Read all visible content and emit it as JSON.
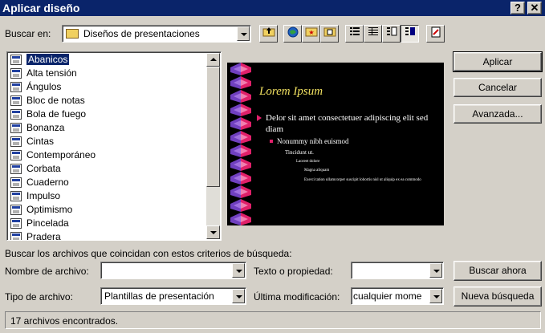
{
  "window": {
    "title": "Aplicar diseño",
    "help_label": "?",
    "close_label": "✕"
  },
  "toolbar": {
    "look_in_label": "Buscar en:",
    "look_in_value": "Diseños de presentaciones",
    "icons": [
      "up-folder-icon",
      "web-search-icon",
      "favorites-icon",
      "views-icon",
      "list-view-icon",
      "details-view-icon",
      "properties-view-icon",
      "preview-view-icon",
      "tools-icon"
    ]
  },
  "file_list": {
    "items": [
      "Abanicos",
      "Alta tensión",
      "Ángulos",
      "Bloc de notas",
      "Bola de fuego",
      "Bonanza",
      "Cintas",
      "Contemporáneo",
      "Corbata",
      "Cuaderno",
      "Impulso",
      "Optimismo",
      "Pincelada",
      "Pradera"
    ],
    "selected_index": 0
  },
  "preview": {
    "title": "Lorem Ipsum",
    "bullet1": "Delor sit amet consectetuer adipiscing elit sed diam",
    "bullet2": "Nonummy nibh euismod",
    "bullet3": "Tincidunt ut.",
    "bullet4": "Laoreet dolore",
    "bullet5": "Magna aliquam",
    "bullet6": "Exerci tation ullamcorper suscipit lobortis nisl ut aliquip ex ea commodo",
    "accent_color": "#e0206a",
    "title_color": "#f0e060"
  },
  "buttons": {
    "apply": "Aplicar",
    "cancel": "Cancelar",
    "advanced": "Avanzada...",
    "find_now": "Buscar ahora",
    "new_search": "Nueva búsqueda"
  },
  "search": {
    "criteria_label": "Buscar los archivos que coincidan con estos criterios de búsqueda:",
    "file_name_label": "Nombre de archivo:",
    "file_name_value": "",
    "text_property_label": "Texto o propiedad:",
    "text_property_value": "",
    "file_type_label": "Tipo de archivo:",
    "file_type_value": "Plantillas de presentación",
    "last_modified_label": "Última modificación:",
    "last_modified_value": "cualquier mome"
  },
  "status": {
    "text": "17 archivos encontrados."
  }
}
